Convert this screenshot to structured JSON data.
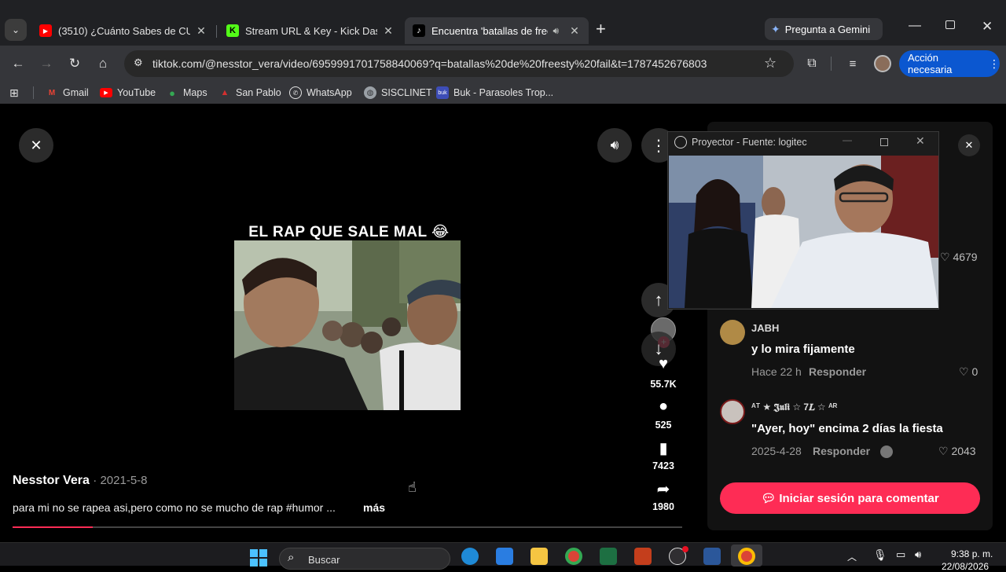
{
  "browser": {
    "tabs": [
      {
        "title": "(3510) ¿Cuánto Sabes de CULTU",
        "close": "✕"
      },
      {
        "title": "Stream URL & Key - Kick Dashb",
        "close": "✕"
      },
      {
        "title": "Encuentra 'batallas de freest",
        "close": "✕"
      }
    ],
    "new_tab": "+",
    "gemini": "Pregunta a Gemini",
    "url": "tiktok.com/@nesstor_vera/video/6959991701758840069?q=batallas%20de%20freesty%20fail&t=1787452676803",
    "accion": "Acción necesaria",
    "bookmarks": [
      "Gmail",
      "YouTube",
      "Maps",
      "San Pablo",
      "WhatsApp",
      "SISCLINET",
      "Buk - Parasoles Trop..."
    ]
  },
  "video": {
    "caption_overlay": "EL RAP QUE SALE MAL 😂",
    "author": "Nesstor Vera",
    "date": "· 2021-5-8",
    "description": "para mi no se rapea asi,pero como no se mucho de rap #humor ...",
    "more": "más",
    "progress": 0.12,
    "stats": {
      "likes": "55.7K",
      "comments": "525",
      "saves": "7423",
      "shares": "1980"
    }
  },
  "projector": {
    "title": "Proyector - Fuente: logitec"
  },
  "comments": [
    {
      "likes": "4679"
    },
    {
      "name": "JABH",
      "text": "y lo mira fijamente",
      "time": "Hace 22 h",
      "reply": "Responder",
      "likes": "0"
    },
    {
      "name": "ᴬᵀ ★ 𝕵𝖚𝖑𝖎 ☆ 7𝑳 ☆ ᴬᴿ",
      "text": "\"Ayer, hoy\" encima 2 días la fiesta",
      "time": "2025-4-28",
      "reply": "Responder",
      "likes": "2043"
    }
  ],
  "login_button": "Iniciar sesión para comentar",
  "taskbar": {
    "search": "Buscar",
    "time": "9:38 p. m.",
    "date": "22/08/2026"
  },
  "colors": {
    "accent": "#fe2c55",
    "chrome_bg": "#35363a",
    "tab_bg": "#202124"
  }
}
